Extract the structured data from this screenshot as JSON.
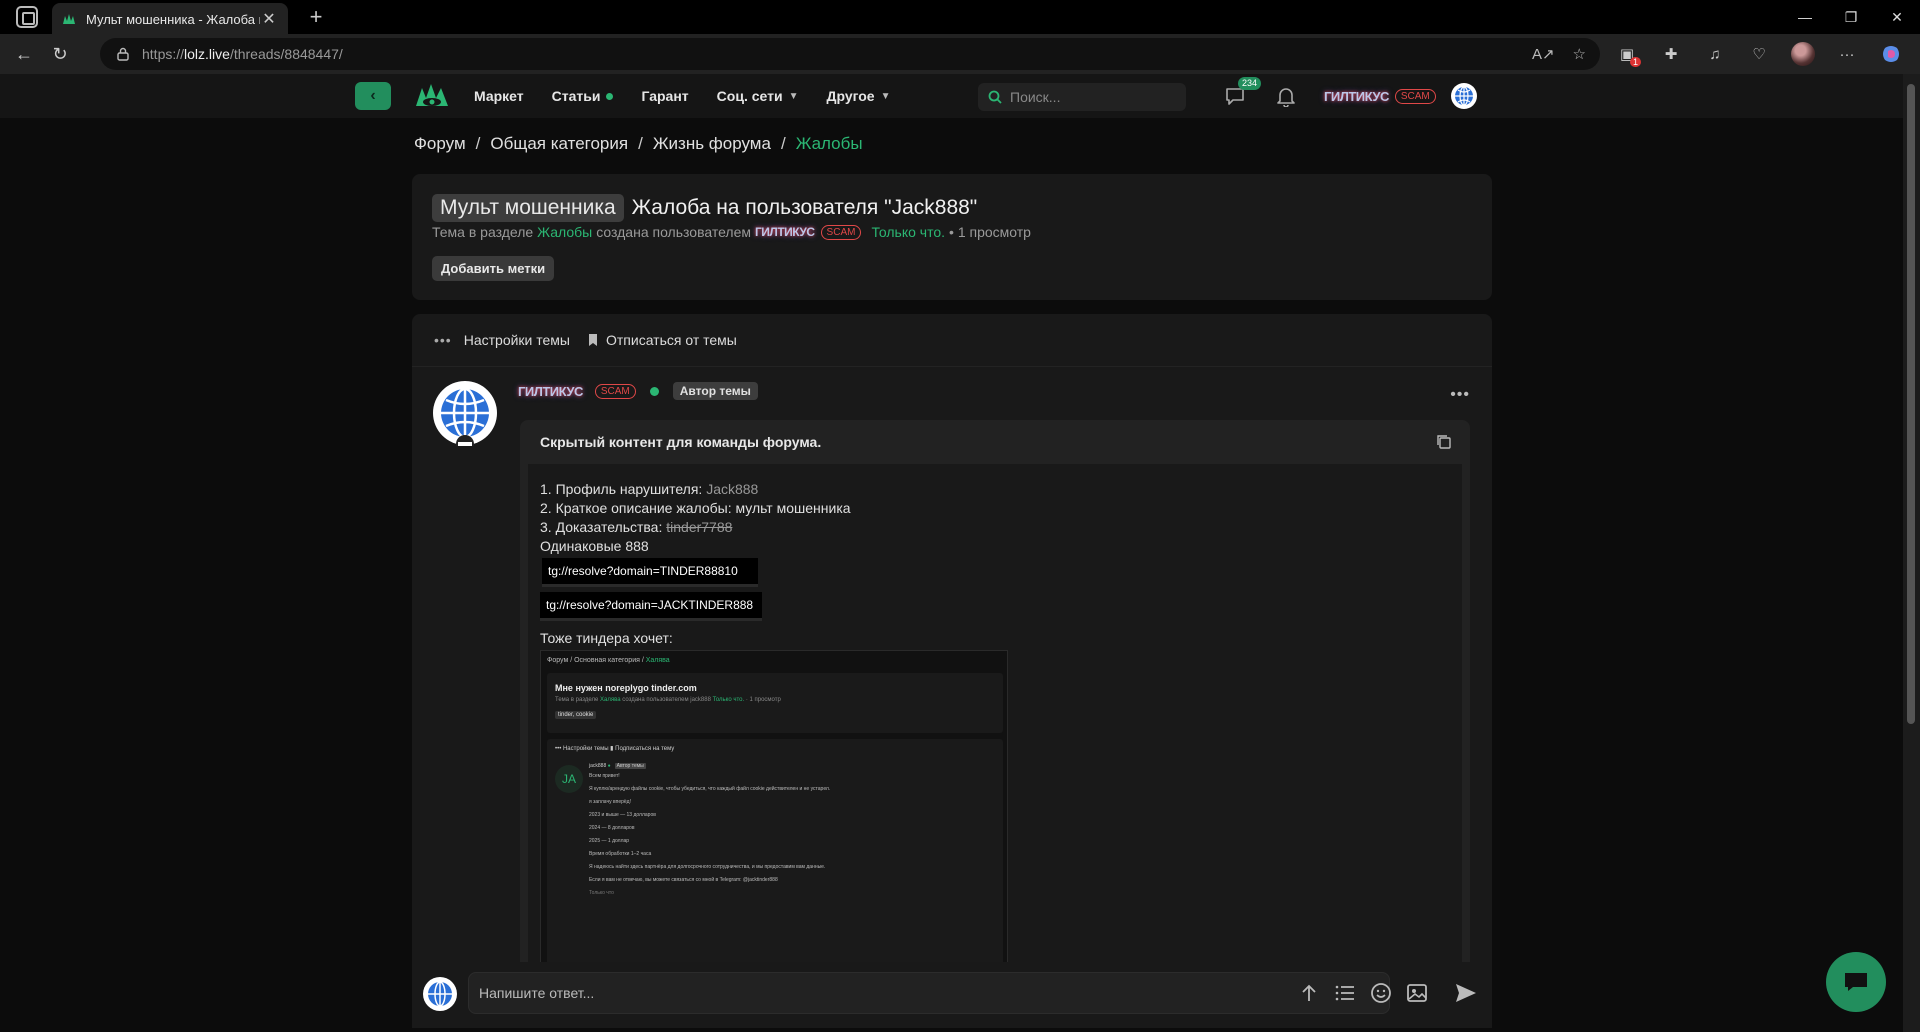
{
  "browser": {
    "tab_title": "Мульт мошенника - Жалоба на пользователя \"Jack888\"",
    "url_prefix": "https://",
    "url_domain": "lolz.live",
    "url_path": "/threads/8848447/",
    "extension_badge": "1"
  },
  "header": {
    "nav": [
      {
        "label": "Маркет"
      },
      {
        "label": "Статьи"
      },
      {
        "label": "Гарант"
      },
      {
        "label": "Соц. сети"
      },
      {
        "label": "Другое"
      }
    ],
    "search_placeholder": "Поиск...",
    "messages_count": "234",
    "username": "ГИЛТИКУС",
    "user_tag": "SCAM"
  },
  "breadcrumb": [
    "Форум",
    "Общая категория",
    "Жизнь форума",
    "Жалобы"
  ],
  "thread": {
    "prefix": "Мульт мошенника",
    "title": "Жалоба на пользователя \"Jack888\"",
    "meta_1": "Тема в разделе",
    "meta_section": "Жалобы",
    "meta_2": "создана пользователем",
    "meta_user": "ГИЛТИКУС",
    "meta_tag": "SCAM",
    "meta_time": "Только что.",
    "meta_views": "• 1 просмотр",
    "add_tags": "Добавить метки"
  },
  "tools": {
    "settings": "Настройки темы",
    "unsubscribe": "Отписаться от темы"
  },
  "post": {
    "author": "ГИЛТИКУС",
    "author_tag": "SCAM",
    "author_badge": "Автор темы",
    "hidden_title": "Скрытый контент для команды форума.",
    "line1_label": "1. Профиль нарушителя:",
    "line1_value": "Jack888",
    "line2": "2. Краткое описание жалобы: мульт мошенника",
    "line3_label": "3. Доказательства:",
    "line3_value": "tinder7788",
    "line4": "Одинаковые 888",
    "code1": "tg://resolve?domain=TINDER88810",
    "code2": "tg://resolve?domain=JACKTINDER888",
    "line5": "Тоже тиндера хочет:"
  },
  "screenshot": {
    "bc_1": "Форум",
    "bc_2": "Основная категория",
    "bc_3": "Халява",
    "title": "Мне нужен noreplygo tinder.com",
    "meta_1": "Тема в разделе",
    "meta_section": "Халява",
    "meta_2": "создана пользователем jack888",
    "meta_time": "Только что.",
    "meta_views": "· 1 просмотр",
    "tags": "tinder, cookie",
    "tools_settings": "Настройки темы",
    "tools_sub": "Подписаться на тему",
    "avatar_initials": "JA",
    "author": "jack888",
    "author_badge": "Автор темы",
    "lines": [
      "Всем привет!",
      "Я куплю/арендую файлы cookie, чтобы убедиться, что каждый файл cookie действителен и не устарел.",
      "я заплачу вперёд!",
      "2023 и выше — 13 долларов",
      "2024 — 8 долларов",
      "2025 — 1 доллар",
      "Время обработки 1–2 часа",
      "Я надеюсь найти здесь партнёра для долгосрочного сотрудничества, и мы предоставим вам данные.",
      "Если я вам не отвечаю, вы можете связаться со мной в Telegram: @jacktinder888"
    ],
    "time": "Только что",
    "likes": "1"
  },
  "reply": {
    "placeholder": "Напишите ответ..."
  }
}
